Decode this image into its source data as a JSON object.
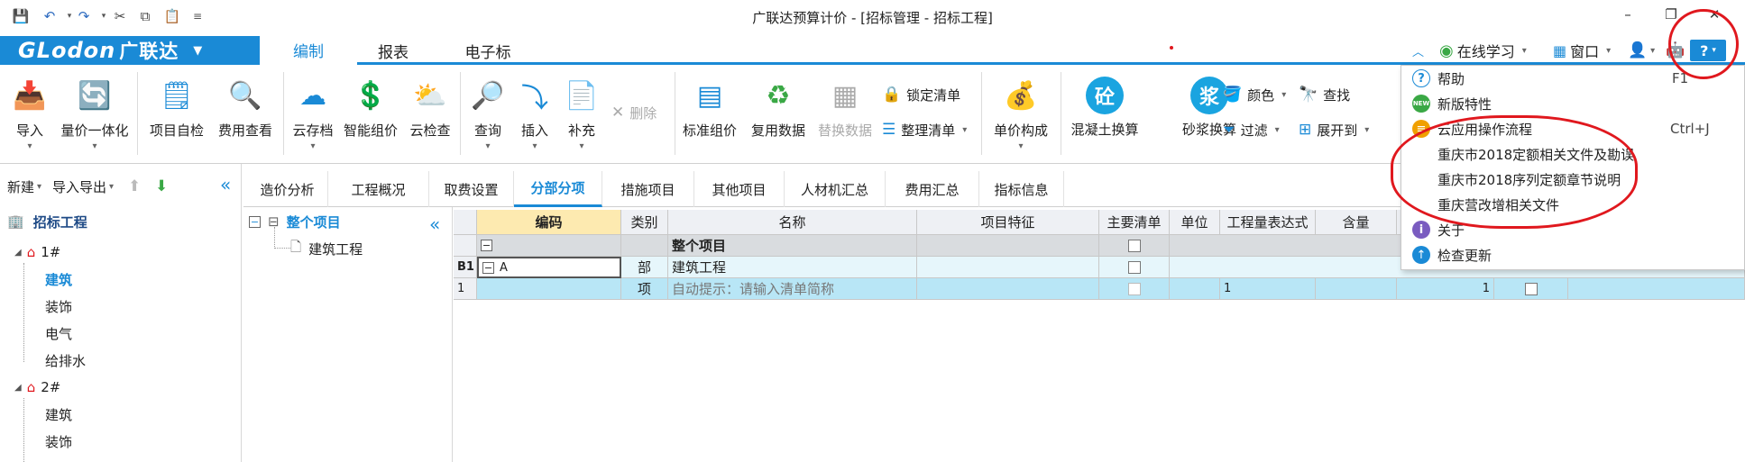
{
  "window": {
    "title": "广联达预算计价 - [招标管理 - 招标工程]",
    "min": "–",
    "restore": "❐",
    "close": "✕"
  },
  "brand": {
    "logo": "GLodon",
    "logo_cn": "广联达"
  },
  "menu": {
    "tabs": [
      "编制",
      "报表",
      "电子标"
    ],
    "online_learning": "在线学习",
    "window": "窗口",
    "help_glyph": "?"
  },
  "ribbon": {
    "import": "导入",
    "unified_price": "量价一体化",
    "self_check": "项目自检",
    "fee_view": "费用查看",
    "cloud_archive": "云存档",
    "smart_price": "智能组价",
    "cloud_check": "云检查",
    "query": "查询",
    "insert": "插入",
    "supplement": "补充",
    "delete": "删除",
    "std_price": "标准组价",
    "reuse_data": "复用数据",
    "replace_data": "替换数据",
    "lock_list": "锁定清单",
    "organize_list": "整理清单",
    "unit_price_comp": "单价构成",
    "concrete": "混凝土换算",
    "concrete_glyph": "砼",
    "mortar": "砂浆换算",
    "mortar_glyph": "浆",
    "color": "颜色",
    "find": "查找",
    "filter": "过滤",
    "expand": "展开到"
  },
  "leftpanel": {
    "new": "新建",
    "import_export": "导入导出",
    "root": "招标工程",
    "nodes": [
      "1#",
      "建筑",
      "装饰",
      "电气",
      "给排水",
      "2#",
      "建筑",
      "装饰"
    ]
  },
  "subtabs": [
    "造价分析",
    "工程概况",
    "取费设置",
    "分部分项",
    "措施项目",
    "其他项目",
    "人材机汇总",
    "费用汇总",
    "指标信息"
  ],
  "midtree": {
    "root": "整个项目",
    "child": "建筑工程"
  },
  "grid": {
    "headers": [
      "编码",
      "类别",
      "名称",
      "项目特征",
      "主要清单",
      "单位",
      "工程量表达式",
      "含量"
    ],
    "row0": {
      "name": "整个项目"
    },
    "row1": {
      "idx": "B1",
      "code": "A",
      "type": "部",
      "name": "建筑工程"
    },
    "row2": {
      "idx": "1",
      "type": "项",
      "name": "自动提示：请输入清单简称",
      "expr": "1",
      "qty": "1"
    }
  },
  "helpmenu": {
    "items": [
      {
        "label": "帮助",
        "shortcut": "F1"
      },
      {
        "label": "新版特性",
        "icon_text": "NEW"
      },
      {
        "label": "云应用操作流程",
        "shortcut": "Ctrl+J"
      },
      {
        "label": "重庆市2018定额相关文件及勘误"
      },
      {
        "label": "重庆市2018序列定额章节说明"
      },
      {
        "label": "重庆营改增相关文件"
      },
      {
        "label": "关于",
        "icon_text": "i"
      },
      {
        "label": "检查更新"
      }
    ]
  }
}
